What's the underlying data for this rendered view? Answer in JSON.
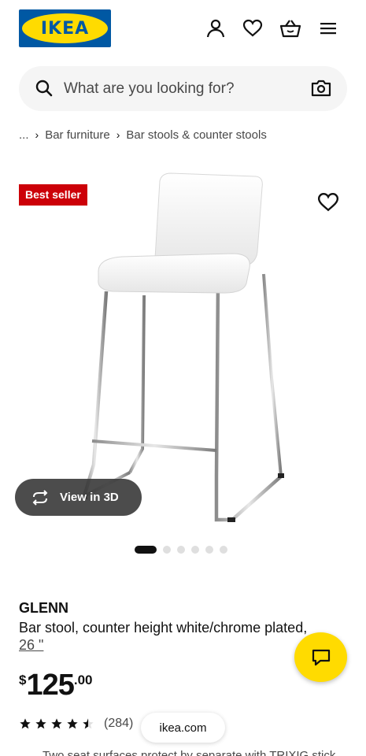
{
  "header": {
    "logo_text": "IKEA",
    "icons": [
      "account-icon",
      "heart-icon",
      "basket-icon",
      "menu-icon"
    ]
  },
  "search": {
    "placeholder": "What are you looking for?"
  },
  "breadcrumb": {
    "items": [
      "...",
      "Bar furniture",
      "Bar stools & counter stools"
    ]
  },
  "product": {
    "badge": "Best seller",
    "view3d_label": "View in 3D",
    "carousel": {
      "total": 6,
      "active": 1
    },
    "name": "GLENN",
    "description": "Bar stool, counter height white/chrome plated,",
    "measure": "26 \"",
    "price": {
      "currency": "$",
      "integer": "125",
      "decimal": ".00"
    },
    "rating": {
      "stars": 4.5,
      "max": 5,
      "count": "(284)"
    }
  },
  "browser": {
    "domain": "ikea.com"
  },
  "colors": {
    "brand_blue": "#0058a3",
    "brand_yellow": "#ffdb00",
    "badge_red": "#cc0008"
  },
  "cut_off_text": "Two seat surfaces protect by separate with TRIXIG stick"
}
